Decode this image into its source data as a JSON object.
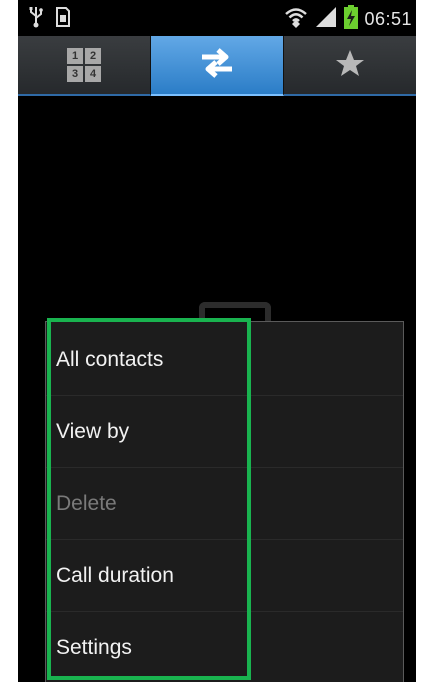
{
  "status_bar": {
    "time": "06:51",
    "icons": [
      "usb-icon",
      "sim-card-icon",
      "wifi-icon",
      "signal-icon",
      "battery-charging-icon"
    ]
  },
  "tabs": [
    {
      "name": "keypad",
      "icon": "keypad-icon",
      "keys": [
        "1",
        "2",
        "3",
        "4"
      ],
      "active": false
    },
    {
      "name": "logs",
      "icon": "swap-arrows-icon",
      "active": true
    },
    {
      "name": "favorites",
      "icon": "star-icon",
      "active": false
    }
  ],
  "menu": {
    "items": [
      {
        "label": "All contacts",
        "enabled": true
      },
      {
        "label": "View by",
        "enabled": true
      },
      {
        "label": "Delete",
        "enabled": false
      },
      {
        "label": "Call duration",
        "enabled": true
      },
      {
        "label": "Settings",
        "enabled": true
      }
    ]
  },
  "colors": {
    "active_tab": "#3b8fd8",
    "highlight": "#19b34f",
    "menu_bg": "#1c1c1c"
  }
}
